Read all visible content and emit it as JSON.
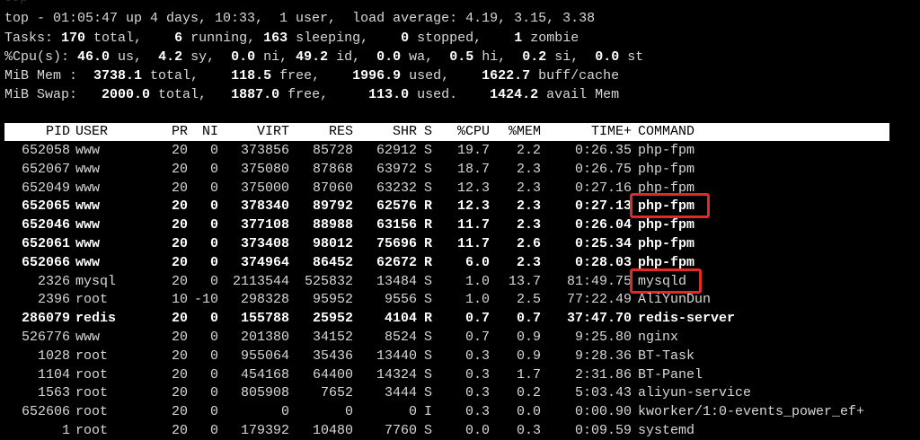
{
  "window": {
    "title_fragment": "top"
  },
  "summary": {
    "line1": "top - 01:05:47 up 4 days, 10:33,  1 user,  load average: 4.19, 3.15, 3.38",
    "tasks": {
      "label": "Tasks:",
      "total": "170",
      "running": "6",
      "sleeping": "163",
      "stopped": "0",
      "zombie": "1"
    },
    "cpu": {
      "label": "%Cpu(s):",
      "us": "46.0",
      "sy": "4.2",
      "ni": "0.0",
      "id": "49.2",
      "wa": "0.0",
      "hi": "0.5",
      "si": "0.2",
      "st": "0.0"
    },
    "mem": {
      "label": "MiB Mem :",
      "total": "3738.1",
      "free": "118.5",
      "used": "1996.9",
      "buff_cache": "1622.7"
    },
    "swap": {
      "label": "MiB Swap:",
      "total": "2000.0",
      "free": "1887.0",
      "used": "113.0",
      "avail_mem": "1424.2"
    }
  },
  "table": {
    "headers": {
      "pid": "PID",
      "user": "USER",
      "pr": "PR",
      "ni": "NI",
      "virt": "VIRT",
      "res": "RES",
      "shr": "SHR",
      "s": "S",
      "cpu": "%CPU",
      "mem": "%MEM",
      "time": "TIME+",
      "command": "COMMAND"
    },
    "rows": [
      {
        "pid": "652058",
        "user": "www",
        "pr": "20",
        "ni": "0",
        "virt": "373856",
        "res": "85728",
        "shr": "62912",
        "s": "S",
        "cpu": "19.7",
        "mem": "2.2",
        "time": "0:26.35",
        "command": "php-fpm",
        "bold": false,
        "highlighted": false
      },
      {
        "pid": "652067",
        "user": "www",
        "pr": "20",
        "ni": "0",
        "virt": "375080",
        "res": "87868",
        "shr": "63972",
        "s": "S",
        "cpu": "18.7",
        "mem": "2.3",
        "time": "0:26.75",
        "command": "php-fpm",
        "bold": false,
        "highlighted": false
      },
      {
        "pid": "652049",
        "user": "www",
        "pr": "20",
        "ni": "0",
        "virt": "375000",
        "res": "87060",
        "shr": "63232",
        "s": "S",
        "cpu": "12.3",
        "mem": "2.3",
        "time": "0:27.16",
        "command": "php-fpm",
        "bold": false,
        "highlighted": false
      },
      {
        "pid": "652065",
        "user": "www",
        "pr": "20",
        "ni": "0",
        "virt": "378340",
        "res": "89792",
        "shr": "62576",
        "s": "R",
        "cpu": "12.3",
        "mem": "2.3",
        "time": "0:27.13",
        "command": "php-fpm",
        "bold": true,
        "highlighted": true
      },
      {
        "pid": "652046",
        "user": "www",
        "pr": "20",
        "ni": "0",
        "virt": "377108",
        "res": "88988",
        "shr": "63156",
        "s": "R",
        "cpu": "11.7",
        "mem": "2.3",
        "time": "0:26.04",
        "command": "php-fpm",
        "bold": true,
        "highlighted": false
      },
      {
        "pid": "652061",
        "user": "www",
        "pr": "20",
        "ni": "0",
        "virt": "373408",
        "res": "98012",
        "shr": "75696",
        "s": "R",
        "cpu": "11.7",
        "mem": "2.6",
        "time": "0:25.34",
        "command": "php-fpm",
        "bold": true,
        "highlighted": false
      },
      {
        "pid": "652066",
        "user": "www",
        "pr": "20",
        "ni": "0",
        "virt": "374964",
        "res": "86452",
        "shr": "62672",
        "s": "R",
        "cpu": "6.0",
        "mem": "2.3",
        "time": "0:28.03",
        "command": "php-fpm",
        "bold": true,
        "highlighted": false
      },
      {
        "pid": "2326",
        "user": "mysql",
        "pr": "20",
        "ni": "0",
        "virt": "2113544",
        "res": "525832",
        "shr": "13484",
        "s": "S",
        "cpu": "1.0",
        "mem": "13.7",
        "time": "81:49.75",
        "command": "mysqld",
        "bold": false,
        "highlighted": true
      },
      {
        "pid": "2396",
        "user": "root",
        "pr": "10",
        "ni": "-10",
        "virt": "298328",
        "res": "95952",
        "shr": "9556",
        "s": "S",
        "cpu": "1.0",
        "mem": "2.5",
        "time": "77:22.49",
        "command": "AliYunDun",
        "bold": false,
        "highlighted": false
      },
      {
        "pid": "286079",
        "user": "redis",
        "pr": "20",
        "ni": "0",
        "virt": "155788",
        "res": "25952",
        "shr": "4104",
        "s": "R",
        "cpu": "0.7",
        "mem": "0.7",
        "time": "37:47.70",
        "command": "redis-server",
        "bold": true,
        "highlighted": false
      },
      {
        "pid": "526776",
        "user": "www",
        "pr": "20",
        "ni": "0",
        "virt": "201380",
        "res": "34152",
        "shr": "8524",
        "s": "S",
        "cpu": "0.7",
        "mem": "0.9",
        "time": "9:25.80",
        "command": "nginx",
        "bold": false,
        "highlighted": false
      },
      {
        "pid": "1028",
        "user": "root",
        "pr": "20",
        "ni": "0",
        "virt": "955064",
        "res": "35436",
        "shr": "13440",
        "s": "S",
        "cpu": "0.3",
        "mem": "0.9",
        "time": "9:28.36",
        "command": "BT-Task",
        "bold": false,
        "highlighted": false
      },
      {
        "pid": "1104",
        "user": "root",
        "pr": "20",
        "ni": "0",
        "virt": "454168",
        "res": "64400",
        "shr": "14324",
        "s": "S",
        "cpu": "0.3",
        "mem": "1.7",
        "time": "2:31.86",
        "command": "BT-Panel",
        "bold": false,
        "highlighted": false
      },
      {
        "pid": "1563",
        "user": "root",
        "pr": "20",
        "ni": "0",
        "virt": "805908",
        "res": "7652",
        "shr": "3444",
        "s": "S",
        "cpu": "0.3",
        "mem": "0.2",
        "time": "5:03.43",
        "command": "aliyun-service",
        "bold": false,
        "highlighted": false
      },
      {
        "pid": "652606",
        "user": "root",
        "pr": "20",
        "ni": "0",
        "virt": "0",
        "res": "0",
        "shr": "0",
        "s": "I",
        "cpu": "0.3",
        "mem": "0.0",
        "time": "0:00.90",
        "command": "kworker/1:0-events_power_ef+",
        "bold": false,
        "highlighted": false
      },
      {
        "pid": "1",
        "user": "root",
        "pr": "20",
        "ni": "0",
        "virt": "179392",
        "res": "10480",
        "shr": "7760",
        "s": "S",
        "cpu": "0.0",
        "mem": "0.3",
        "time": "0:09.59",
        "command": "systemd",
        "bold": false,
        "highlighted": false
      }
    ]
  },
  "colors": {
    "background": "#000000",
    "text": "#d8d8d8",
    "bold_text": "#ffffff",
    "header_bg": "#ffffff",
    "header_text": "#000000",
    "highlight_box": "#e02a2a"
  }
}
